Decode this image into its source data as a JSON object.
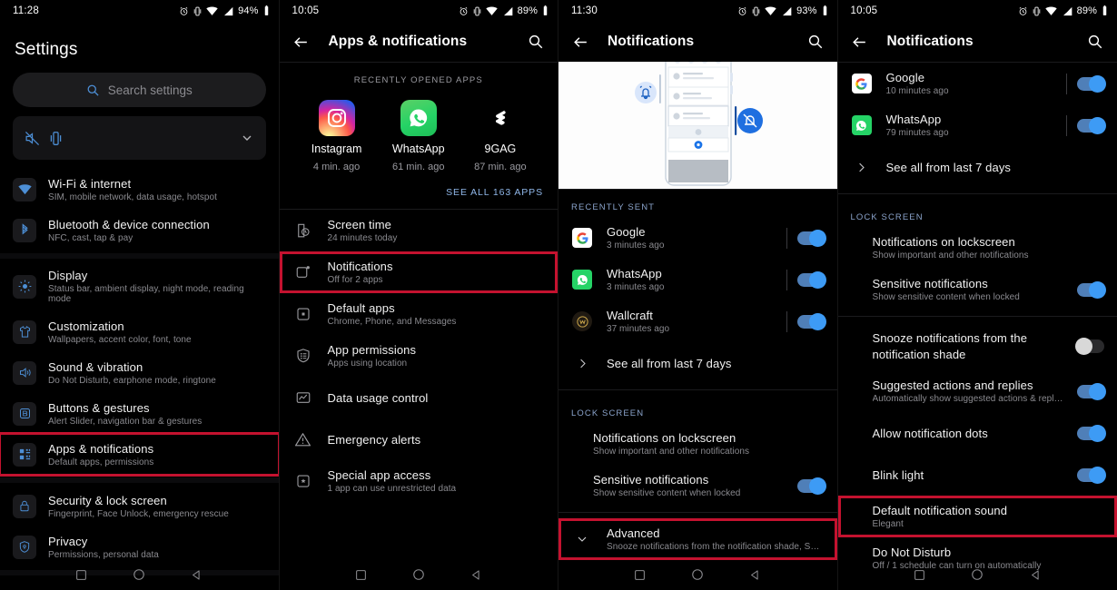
{
  "panels": [
    {
      "id": "settings-home",
      "status": {
        "time": "11:28",
        "battery": "94%"
      },
      "title": "Settings",
      "search": {
        "placeholder": "Search settings"
      },
      "suggestion": {
        "icons": "silent-vibrate"
      },
      "items": [
        {
          "title": "Wi-Fi & internet",
          "sub": "SIM, mobile network, data usage, hotspot",
          "icon": "wifi-icon",
          "highlight": false
        },
        {
          "title": "Bluetooth & device connection",
          "sub": "NFC, cast, tap & pay",
          "icon": "bluetooth-icon",
          "highlight": false
        },
        {
          "title": "Display",
          "sub": "Status bar, ambient display, night mode, reading mode",
          "icon": "display-icon",
          "highlight": false
        },
        {
          "title": "Customization",
          "sub": "Wallpapers, accent color, font, tone",
          "icon": "shirt-icon",
          "highlight": false
        },
        {
          "title": "Sound & vibration",
          "sub": "Do Not Disturb, earphone mode, ringtone",
          "icon": "speaker-icon",
          "highlight": false
        },
        {
          "title": "Buttons & gestures",
          "sub": "Alert Slider, navigation bar & gestures",
          "icon": "buttons-icon",
          "highlight": false
        },
        {
          "title": "Apps & notifications",
          "sub": "Default apps, permissions",
          "icon": "apps-grid-icon",
          "highlight": true
        },
        {
          "title": "Security & lock screen",
          "sub": "Fingerprint, Face Unlock, emergency rescue",
          "icon": "lock-icon",
          "highlight": false
        },
        {
          "title": "Privacy",
          "sub": "Permissions, personal data",
          "icon": "privacy-shield-icon",
          "highlight": false
        }
      ]
    },
    {
      "id": "apps-and-notifications",
      "status": {
        "time": "10:05",
        "battery": "89%"
      },
      "title": "Apps & notifications",
      "recent_label": "RECENTLY OPENED APPS",
      "recent_apps": [
        {
          "name": "Instagram",
          "time": "4 min. ago",
          "icon": "instagram-icon"
        },
        {
          "name": "WhatsApp",
          "time": "61 min. ago",
          "icon": "whatsapp-icon"
        },
        {
          "name": "9GAG",
          "time": "87 min. ago",
          "icon": "ninegag-icon"
        }
      ],
      "see_all": "SEE ALL 163 APPS",
      "items": [
        {
          "title": "Screen time",
          "sub": "24 minutes today",
          "icon": "screen-time-icon",
          "highlight": false
        },
        {
          "title": "Notifications",
          "sub": "Off for 2 apps",
          "icon": "notifications-icon",
          "highlight": true
        },
        {
          "title": "Default apps",
          "sub": "Chrome, Phone, and Messages",
          "icon": "default-apps-icon",
          "highlight": false
        },
        {
          "title": "App permissions",
          "sub": "Apps using location",
          "icon": "permissions-icon",
          "highlight": false
        },
        {
          "title": "Data usage control",
          "sub": "",
          "icon": "data-usage-icon",
          "highlight": false
        },
        {
          "title": "Emergency alerts",
          "sub": "",
          "icon": "warning-icon",
          "highlight": false
        },
        {
          "title": "Special app access",
          "sub": "1 app can use unrestricted data",
          "icon": "special-access-icon",
          "highlight": false
        }
      ]
    },
    {
      "id": "notifications-top",
      "status": {
        "time": "11:30",
        "battery": "93%"
      },
      "title": "Notifications",
      "recently_sent_label": "RECENTLY SENT",
      "recently_sent": [
        {
          "name": "Google",
          "time": "3 minutes ago",
          "icon": "google-icon",
          "toggle": "on"
        },
        {
          "name": "WhatsApp",
          "time": "3 minutes ago",
          "icon": "whatsapp-icon",
          "toggle": "on"
        },
        {
          "name": "Wallcraft",
          "time": "37 minutes ago",
          "icon": "wallcraft-icon",
          "toggle": "on"
        }
      ],
      "see_all_7_days": "See all from last 7 days",
      "lock_screen_label": "LOCK SCREEN",
      "lock_items": [
        {
          "title": "Notifications on lockscreen",
          "sub": "Show important and other notifications",
          "toggle": "none",
          "highlight": false
        },
        {
          "title": "Sensitive notifications",
          "sub": "Show sensitive content when locked",
          "toggle": "on",
          "highlight": false
        }
      ],
      "advanced": {
        "title": "Advanced",
        "sub": "Snooze notifications from the notification shade, Suggested ac..",
        "highlight": true
      }
    },
    {
      "id": "notifications-expanded",
      "status": {
        "time": "10:05",
        "battery": "89%"
      },
      "title": "Notifications",
      "recently_sent": [
        {
          "name": "Google",
          "time": "10 minutes ago",
          "icon": "google-icon",
          "toggle": "on"
        },
        {
          "name": "WhatsApp",
          "time": "79 minutes ago",
          "icon": "whatsapp-icon",
          "toggle": "on"
        }
      ],
      "see_all_7_days": "See all from last 7 days",
      "lock_screen_label": "LOCK SCREEN",
      "lock_items": [
        {
          "title": "Notifications on lockscreen",
          "sub": "Show important and other notifications",
          "toggle": "none",
          "highlight": false
        },
        {
          "title": "Sensitive notifications",
          "sub": "Show sensitive content when locked",
          "toggle": "on",
          "highlight": false
        }
      ],
      "advanced_items": [
        {
          "title": "Snooze notifications from the notification shade",
          "sub": "",
          "toggle": "off",
          "highlight": false
        },
        {
          "title": "Suggested actions and replies",
          "sub": "Automatically show suggested actions & replies",
          "toggle": "on",
          "highlight": false
        },
        {
          "title": "Allow notification dots",
          "sub": "",
          "toggle": "on",
          "highlight": false
        },
        {
          "title": "Blink light",
          "sub": "",
          "toggle": "on",
          "highlight": false
        },
        {
          "title": "Default notification sound",
          "sub": "Elegant",
          "toggle": "none",
          "highlight": true
        },
        {
          "title": "Do Not Disturb",
          "sub": "Off / 1 schedule can turn on automatically",
          "toggle": "none",
          "highlight": false
        }
      ]
    }
  ],
  "colors": {
    "highlight": "#c4122f",
    "accent_blue": "#3d9bf5",
    "section_blue": "#8ba4cc",
    "link_blue": "#8fb6e8"
  },
  "navbar": {
    "recents": "square-icon",
    "home": "circle-icon",
    "back": "triangle-back-icon"
  }
}
